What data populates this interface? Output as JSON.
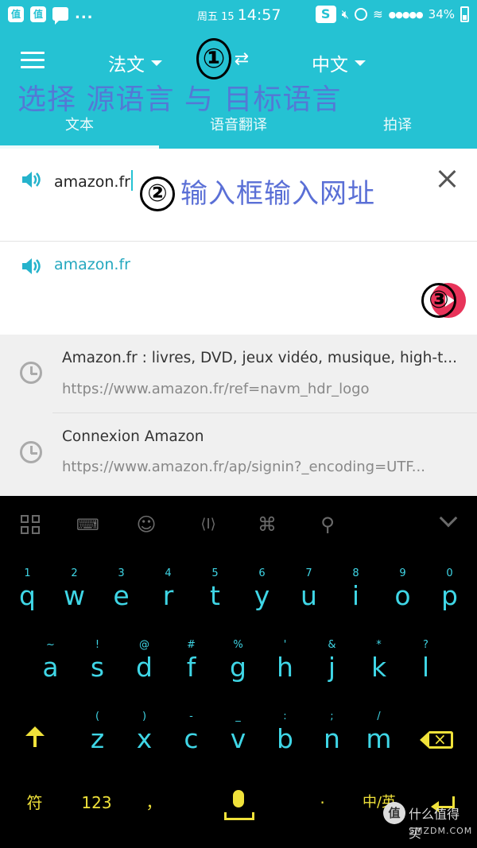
{
  "status_bar": {
    "left_badges": [
      "值",
      "值"
    ],
    "more": "...",
    "date": "周五 15",
    "time": "14:57",
    "app_badge": "S",
    "signal": "●●●●●",
    "battery": "34%"
  },
  "toolbar": {
    "source_lang": "法文",
    "target_lang": "中文",
    "swap_icon": "⇄"
  },
  "tabs": [
    {
      "label": "文本",
      "active": true
    },
    {
      "label": "语音翻译",
      "active": false
    },
    {
      "label": "拍译",
      "active": false
    }
  ],
  "annotations": {
    "one": "①",
    "one_text": "选择 源语言 与 目标语言",
    "two": "②",
    "two_text": "输入框输入网址",
    "three": "③"
  },
  "input": {
    "value": "amazon.fr"
  },
  "result": {
    "text": "amazon.fr"
  },
  "history": [
    {
      "title": "Amazon.fr : livres, DVD, jeux vidéo, musique, high-t...",
      "url": "https://www.amazon.fr/ref=navm_hdr_logo"
    },
    {
      "title": "Connexion Amazon",
      "url": "https://www.amazon.fr/ap/signin?_encoding=UTF..."
    }
  ],
  "keyboard": {
    "toolbar_icons": {
      "smile": "☺",
      "cursor": "⟨I⟩",
      "link": "⌘",
      "search": "⚲"
    },
    "row1": [
      {
        "hint": "1",
        "key": "q"
      },
      {
        "hint": "2",
        "key": "w"
      },
      {
        "hint": "3",
        "key": "e"
      },
      {
        "hint": "4",
        "key": "r"
      },
      {
        "hint": "5",
        "key": "t"
      },
      {
        "hint": "6",
        "key": "y"
      },
      {
        "hint": "7",
        "key": "u"
      },
      {
        "hint": "8",
        "key": "i"
      },
      {
        "hint": "9",
        "key": "o"
      },
      {
        "hint": "0",
        "key": "p"
      }
    ],
    "row2": [
      {
        "hint": "~",
        "key": "a"
      },
      {
        "hint": "!",
        "key": "s"
      },
      {
        "hint": "@",
        "key": "d"
      },
      {
        "hint": "#",
        "key": "f"
      },
      {
        "hint": "%",
        "key": "g"
      },
      {
        "hint": "'",
        "key": "h"
      },
      {
        "hint": "&",
        "key": "j"
      },
      {
        "hint": "*",
        "key": "k"
      },
      {
        "hint": "?",
        "key": "l"
      }
    ],
    "row3": [
      {
        "hint": "(",
        "key": "z"
      },
      {
        "hint": ")",
        "key": "x"
      },
      {
        "hint": "-",
        "key": "c"
      },
      {
        "hint": "_",
        "key": "v"
      },
      {
        "hint": ":",
        "key": "b"
      },
      {
        "hint": ";",
        "key": "n"
      },
      {
        "hint": "/",
        "key": "m"
      }
    ],
    "row4": {
      "symbols": "符",
      "numbers": "123",
      "comma": "，",
      "period": "·",
      "lang_switch": "中/英"
    }
  },
  "watermark": {
    "logo": "值",
    "cn": "什么值得买",
    "en": "SMZDM.COM"
  }
}
